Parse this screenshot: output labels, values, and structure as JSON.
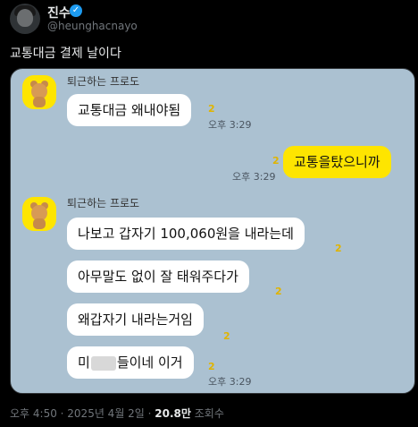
{
  "author": {
    "name": "진수",
    "handle": "@heunghacnayo",
    "verified_mark": "✓"
  },
  "tweet": {
    "text": "교통대금 결제 날이다"
  },
  "chat": {
    "messages_group1_sender": "퇴근하는 프로도",
    "msg1": "교통대금 왜내야됨",
    "msg1_unread": "2",
    "msg1_time": "오후 3:29",
    "my_msg": "교통을탔으니까",
    "my_msg_unread": "2",
    "my_msg_time": "오후 3:29",
    "messages_group2_sender": "퇴근하는 프로도",
    "msg2": "나보고 갑자기 100,060원을 내라는데",
    "msg2_unread": "2",
    "msg3": "아무말도 없이 잘 태워주다가",
    "msg3_unread": "2",
    "msg4": "왜갑자기 내라는거임",
    "msg4_unread": "2",
    "msg5_start": "미",
    "msg5_end": "들이네 이거",
    "msg5_unread": "2",
    "msg5_time": "오후 3:29"
  },
  "meta": {
    "time_date": "오후 4:50 · 2025년 4월 2일 · ",
    "views_count": "20.8만",
    "views_label": " 조회수"
  },
  "colors": {
    "chat_bg": "#abc1d1",
    "my_bubble": "#fee500",
    "verified": "#1d9bf0"
  }
}
